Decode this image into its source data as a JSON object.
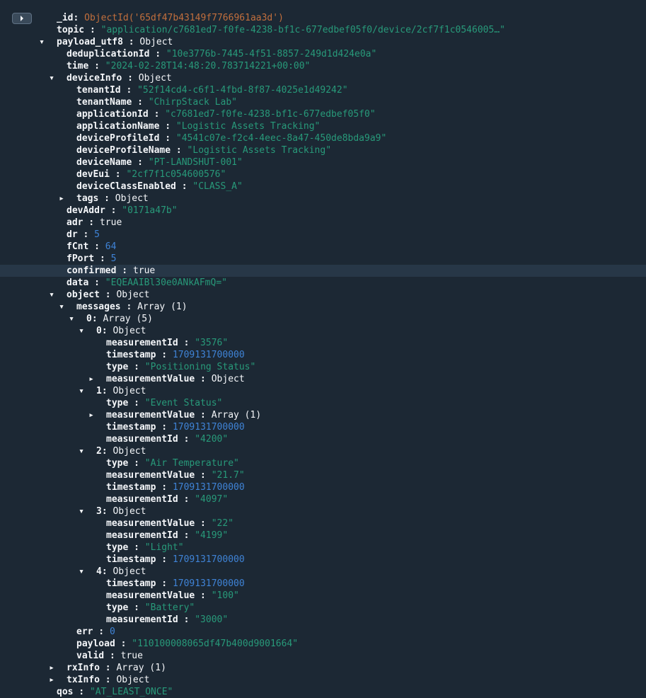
{
  "labels": {
    "object_type": "Object",
    "array1_type": "Array (1)",
    "array5_type": "Array (5)"
  },
  "doc": {
    "id_key": "_id",
    "id_val": "ObjectId('65df47b43149f7766961aa3d')",
    "topic_key": "topic",
    "topic_val": "\"application/c7681ed7-f0fe-4238-bf1c-677edbef05f0/device/2cf7f1c0546005…\"",
    "payload_utf8_key": "payload_utf8",
    "dedup_key": "deduplicationId",
    "dedup_val": "\"10e3776b-7445-4f51-8857-249d1d424e0a\"",
    "time_key": "time",
    "time_val": "\"2024-02-28T14:48:20.783714221+00:00\"",
    "deviceInfo_key": "deviceInfo",
    "tenantId_key": "tenantId",
    "tenantId_val": "\"52f14cd4-c6f1-4fbd-8f87-4025e1d49242\"",
    "tenantName_key": "tenantName",
    "tenantName_val": "\"ChirpStack Lab\"",
    "applicationId_key": "applicationId",
    "applicationId_val": "\"c7681ed7-f0fe-4238-bf1c-677edbef05f0\"",
    "applicationName_key": "applicationName",
    "applicationName_val": "\"Logistic Assets Tracking\"",
    "deviceProfileId_key": "deviceProfileId",
    "deviceProfileId_val": "\"4541c07e-f2c4-4eec-8a47-450de8bda9a9\"",
    "deviceProfileName_key": "deviceProfileName",
    "deviceProfileName_val": "\"Logistic Assets Tracking\"",
    "deviceName_key": "deviceName",
    "deviceName_val": "\"PT-LANDSHUT-001\"",
    "devEui_key": "devEui",
    "devEui_val": "\"2cf7f1c054600576\"",
    "deviceClassEnabled_key": "deviceClassEnabled",
    "deviceClassEnabled_val": "\"CLASS_A\"",
    "tags_key": "tags",
    "devAddr_key": "devAddr",
    "devAddr_val": "\"0171a47b\"",
    "adr_key": "adr",
    "adr_val": "true",
    "dr_key": "dr",
    "dr_val": "5",
    "fCnt_key": "fCnt",
    "fCnt_val": "64",
    "fPort_key": "fPort",
    "fPort_val": "5",
    "confirmed_key": "confirmed",
    "confirmed_val": "true",
    "data_key": "data",
    "data_val": "\"EQEAAIBl30e0ANkAFmQ=\"",
    "object_key": "object",
    "messages_key": "messages",
    "idx0": "0",
    "idx1": "1",
    "idx2": "2",
    "idx3": "3",
    "idx4": "4",
    "measurementId_key": "measurementId",
    "timestamp_key": "timestamp",
    "type_key": "type",
    "measurementValue_key": "measurementValue",
    "m0_measId": "\"3576\"",
    "m0_ts": "1709131700000",
    "m0_type": "\"Positioning Status\"",
    "m1_type": "\"Event Status\"",
    "m1_ts": "1709131700000",
    "m1_measId": "\"4200\"",
    "m2_type": "\"Air Temperature\"",
    "m2_val": "\"21.7\"",
    "m2_ts": "1709131700000",
    "m2_measId": "\"4097\"",
    "m3_val": "\"22\"",
    "m3_measId": "\"4199\"",
    "m3_type": "\"Light\"",
    "m3_ts": "1709131700000",
    "m4_ts": "1709131700000",
    "m4_val": "\"100\"",
    "m4_type": "\"Battery\"",
    "m4_measId": "\"3000\"",
    "err_key": "err",
    "err_val": "0",
    "payload_key": "payload",
    "payload_val": "\"110100008065df47b400d9001664\"",
    "valid_key": "valid",
    "valid_val": "true",
    "rxInfo_key": "rxInfo",
    "txInfo_key": "txInfo",
    "qos_key": "qos",
    "qos_val": "\"AT_LEAST_ONCE\""
  }
}
